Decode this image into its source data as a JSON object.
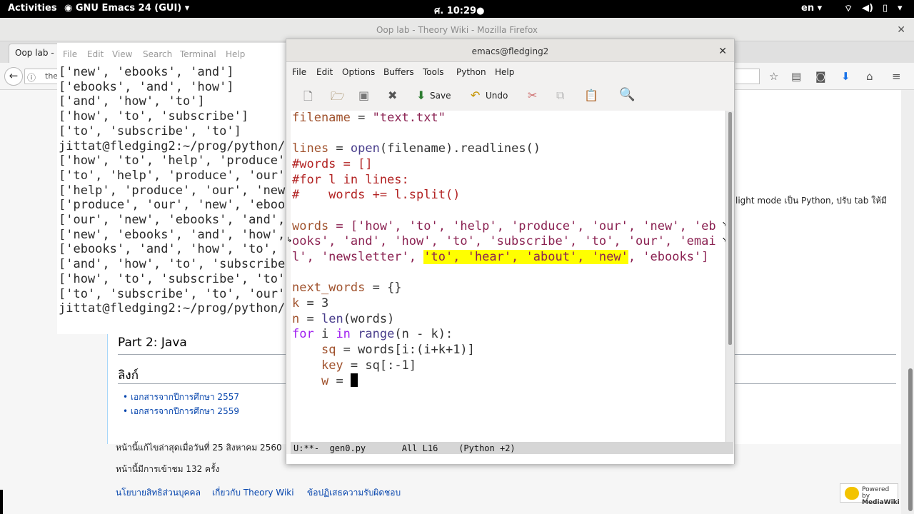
{
  "topbar": {
    "activities": "Activities",
    "app_menu": "GNU Emacs 24 (GUI)",
    "clock": "ศ. 10:29",
    "lang": "en"
  },
  "firefox": {
    "title": "Oop lab - Theory Wiki - Mozilla Firefox",
    "tab_label": "Oop lab -",
    "url_fragment": "the"
  },
  "terminal": {
    "menu": [
      "File",
      "Edit",
      "View",
      "Search",
      "Terminal",
      "Help"
    ],
    "lines": [
      "['new', 'ebooks', 'and']",
      "['ebooks', 'and', 'how']",
      "['and', 'how', 'to']",
      "['how', 'to', 'subscribe']",
      "['to', 'subscribe', 'to']",
      "jittat@fledging2:~/prog/python/",
      "['how', 'to', 'help', 'produce'",
      "['to', 'help', 'produce', 'our'",
      "['help', 'produce', 'our', 'new",
      "['produce', 'our', 'new', 'eboo",
      "['our', 'new', 'ebooks', 'and',",
      "['new', 'ebooks', 'and', 'how',",
      "['ebooks', 'and', 'how', 'to',",
      "['and', 'how', 'to', 'subscribe",
      "['how', 'to', 'subscribe', 'to'",
      "['to', 'subscribe', 'to', 'our'",
      "jittat@fledging2:~/prog/python/"
    ]
  },
  "emacs": {
    "title": "emacs@fledging2",
    "menu": [
      "File",
      "Edit",
      "Options",
      "Buffers",
      "Tools",
      "Python",
      "Help"
    ],
    "toolbar": {
      "save": "Save",
      "undo": "Undo"
    },
    "code": {
      "l1_var": "filename",
      "l1_val": "\"text.txt\"",
      "l3_var": "lines",
      "l3_fn": "open",
      "l3_arg": "(filename).readlines()",
      "l4": "#words = []",
      "l5": "#for l in lines:",
      "l6": "#    words += l.split()",
      "l8_var": "words",
      "l8_rest": " = ['how', 'to', 'help', 'produce', 'our', 'new', 'eb",
      "l9": "ooks', 'and', 'how', 'to', 'subscribe', 'to', 'our', 'emai",
      "l10_pre": "l', 'newsletter', ",
      "l10_hl": "'to', 'hear', 'about', 'new'",
      "l10_post": ", 'ebooks']",
      "l12_var": "next_words",
      "l12_rest": " = {}",
      "l13_var": "k",
      "l13_rest": " = 3",
      "l14_var": "n",
      "l14_mid": " = ",
      "l14_fn": "len",
      "l14_rest": "(words)",
      "l15_for": "for",
      "l15_i": " i ",
      "l15_in": "in",
      "l15_sp": " ",
      "l15_range": "range",
      "l15_rest": "(n - k):",
      "l16_var": "sq",
      "l16_rest": " = words[i:(i+k+1)]",
      "l17_var": "key",
      "l17_rest": " = sq[:-1]",
      "l18_var": "w",
      "l18_rest": " = "
    },
    "modeline": "U:**-  gen0.py       All L16    (Python +2)"
  },
  "wiki": {
    "right_text": "light mode เป็น Python, ปรับ tab ให้มี",
    "part2": "Part 2: Java",
    "links_heading": "ลิงก์",
    "links": [
      "เอกสารจากปีการศึกษา 2557",
      "เอกสารจากปีการศึกษา 2559"
    ],
    "last_edit": "หน้านี้แก้ไขล่าสุดเมื่อวันที่ 25 สิงหาคม 2560",
    "views": "หน้านี้มีการเข้าชม 132 ครั้ง",
    "footer": [
      "นโยบายสิทธิส่วนบุคคล",
      "เกี่ยวกับ Theory Wiki",
      "ข้อปฏิเสธความรับผิดชอบ"
    ],
    "mediawiki_top": "Powered by",
    "mediawiki": "MediaWiki"
  }
}
